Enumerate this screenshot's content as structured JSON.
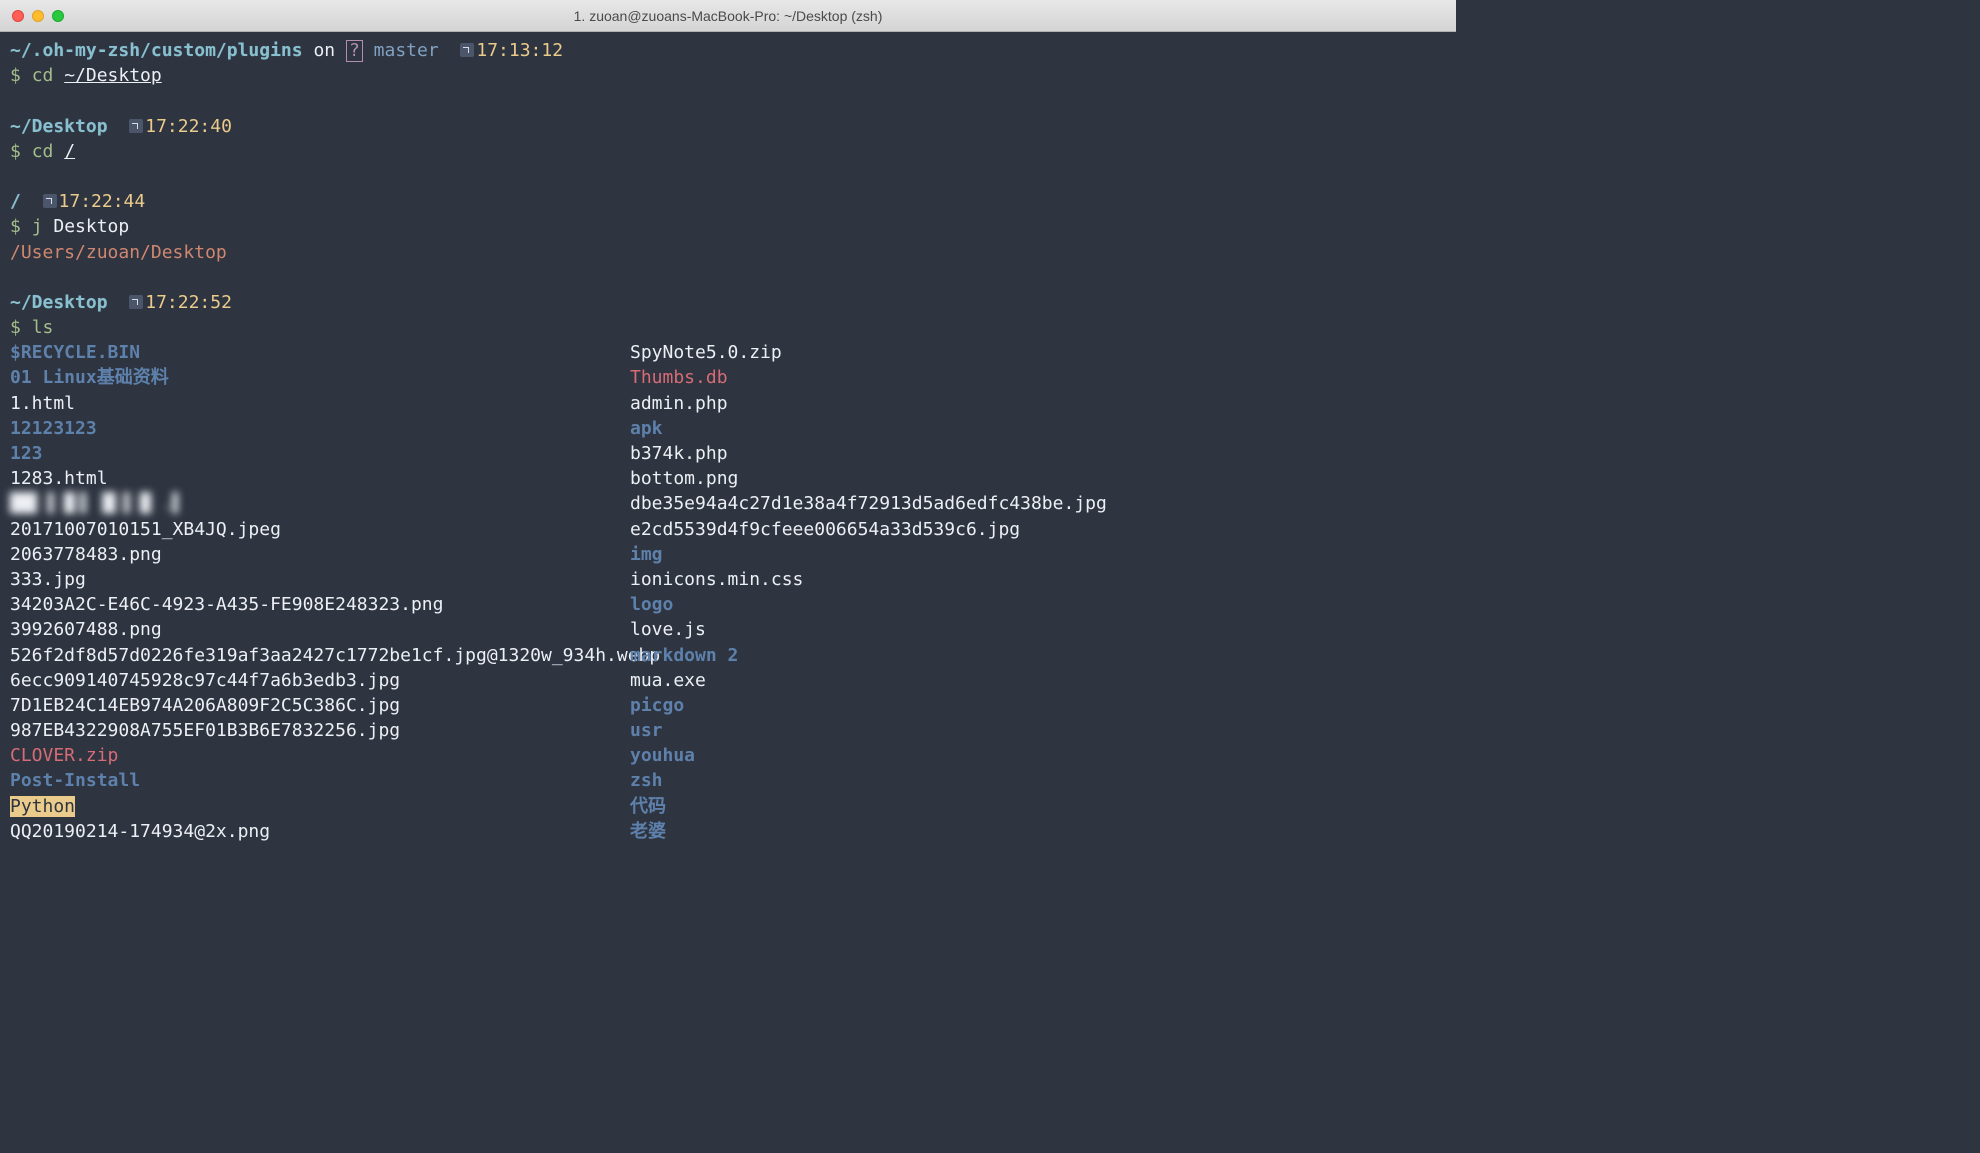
{
  "window": {
    "title": "1. zuoan@zuoans-MacBook-Pro: ~/Desktop (zsh)"
  },
  "blocks": [
    {
      "path": "~/.oh-my-zsh/custom/plugins",
      "on": " on ",
      "branch_mark": "?",
      "branch": "master",
      "time": "17:13:12",
      "prompt": "$ ",
      "cmd_prefix": "cd ",
      "cmd_path": "~/Desktop",
      "output": null
    },
    {
      "path": "~/Desktop",
      "time": "17:22:40",
      "prompt": "$ ",
      "cmd_prefix": "cd ",
      "cmd_path": "/",
      "output": null
    },
    {
      "path": "/",
      "time": "17:22:44",
      "prompt": "$ ",
      "cmd_prefix": "j ",
      "cmd_arg": "Desktop",
      "output": "/Users/zuoan/Desktop"
    },
    {
      "path": "~/Desktop",
      "time": "17:22:52",
      "prompt": "$ ",
      "cmd": "ls"
    }
  ],
  "ls": {
    "col1": [
      {
        "text": "$RECYCLE.BIN",
        "cls": "blue-bold"
      },
      {
        "text": "01 Linux基础资料",
        "cls": "blue-bold"
      },
      {
        "text": "1.html",
        "cls": "white"
      },
      {
        "text": "12123123",
        "cls": "blue-bold"
      },
      {
        "text": "123",
        "cls": "blue-bold"
      },
      {
        "text": "1283.html",
        "cls": "white"
      },
      {
        "text": "██▌▐ █▐ ▐▊▐ █ .▌",
        "cls": "white blur"
      },
      {
        "text": "20171007010151_XB4JQ.jpeg",
        "cls": "white"
      },
      {
        "text": "2063778483.png",
        "cls": "white"
      },
      {
        "text": "333.jpg",
        "cls": "white"
      },
      {
        "text": "34203A2C-E46C-4923-A435-FE908E248323.png",
        "cls": "white"
      },
      {
        "text": "3992607488.png",
        "cls": "white"
      },
      {
        "text": "526f2df8d57d0226fe319af3aa2427c1772be1cf.jpg@1320w_934h.webp",
        "cls": "white"
      },
      {
        "text": "6ecc909140745928c97c44f7a6b3edb3.jpg",
        "cls": "white"
      },
      {
        "text": "7D1EB24C14EB974A206A809F2C5C386C.jpg",
        "cls": "white"
      },
      {
        "text": "987EB4322908A755EF01B3B6E7832256.jpg",
        "cls": "white"
      },
      {
        "text": "CLOVER.zip",
        "cls": "red"
      },
      {
        "text": "Post-Install",
        "cls": "blue-bold"
      },
      {
        "text": "Python",
        "cls": "hl-yellow"
      },
      {
        "text": "QQ20190214-174934@2x.png",
        "cls": "white"
      }
    ],
    "col2": [
      {
        "text": "SpyNote5.0.zip",
        "cls": "white"
      },
      {
        "text": "Thumbs.db",
        "cls": "red"
      },
      {
        "text": "admin.php",
        "cls": "white"
      },
      {
        "text": "apk",
        "cls": "blue-bold"
      },
      {
        "text": "b374k.php",
        "cls": "white"
      },
      {
        "text": "bottom.png",
        "cls": "white"
      },
      {
        "text": "dbe35e94a4c27d1e38a4f72913d5ad6edfc438be.jpg",
        "cls": "white"
      },
      {
        "text": "e2cd5539d4f9cfeee006654a33d539c6.jpg",
        "cls": "white"
      },
      {
        "text": "img",
        "cls": "blue-bold"
      },
      {
        "text": "ionicons.min.css",
        "cls": "white"
      },
      {
        "text": "logo",
        "cls": "blue-bold"
      },
      {
        "text": "love.js",
        "cls": "white"
      },
      {
        "text": "markdown 2",
        "cls": "blue-bold"
      },
      {
        "text": "mua.exe",
        "cls": "white"
      },
      {
        "text": "picgo",
        "cls": "blue-bold"
      },
      {
        "text": "usr",
        "cls": "blue-bold"
      },
      {
        "text": "youhua",
        "cls": "blue-bold"
      },
      {
        "text": "zsh",
        "cls": "blue-bold"
      },
      {
        "text": "代码",
        "cls": "blue-bold"
      },
      {
        "text": "老婆",
        "cls": "blue-bold"
      }
    ]
  }
}
